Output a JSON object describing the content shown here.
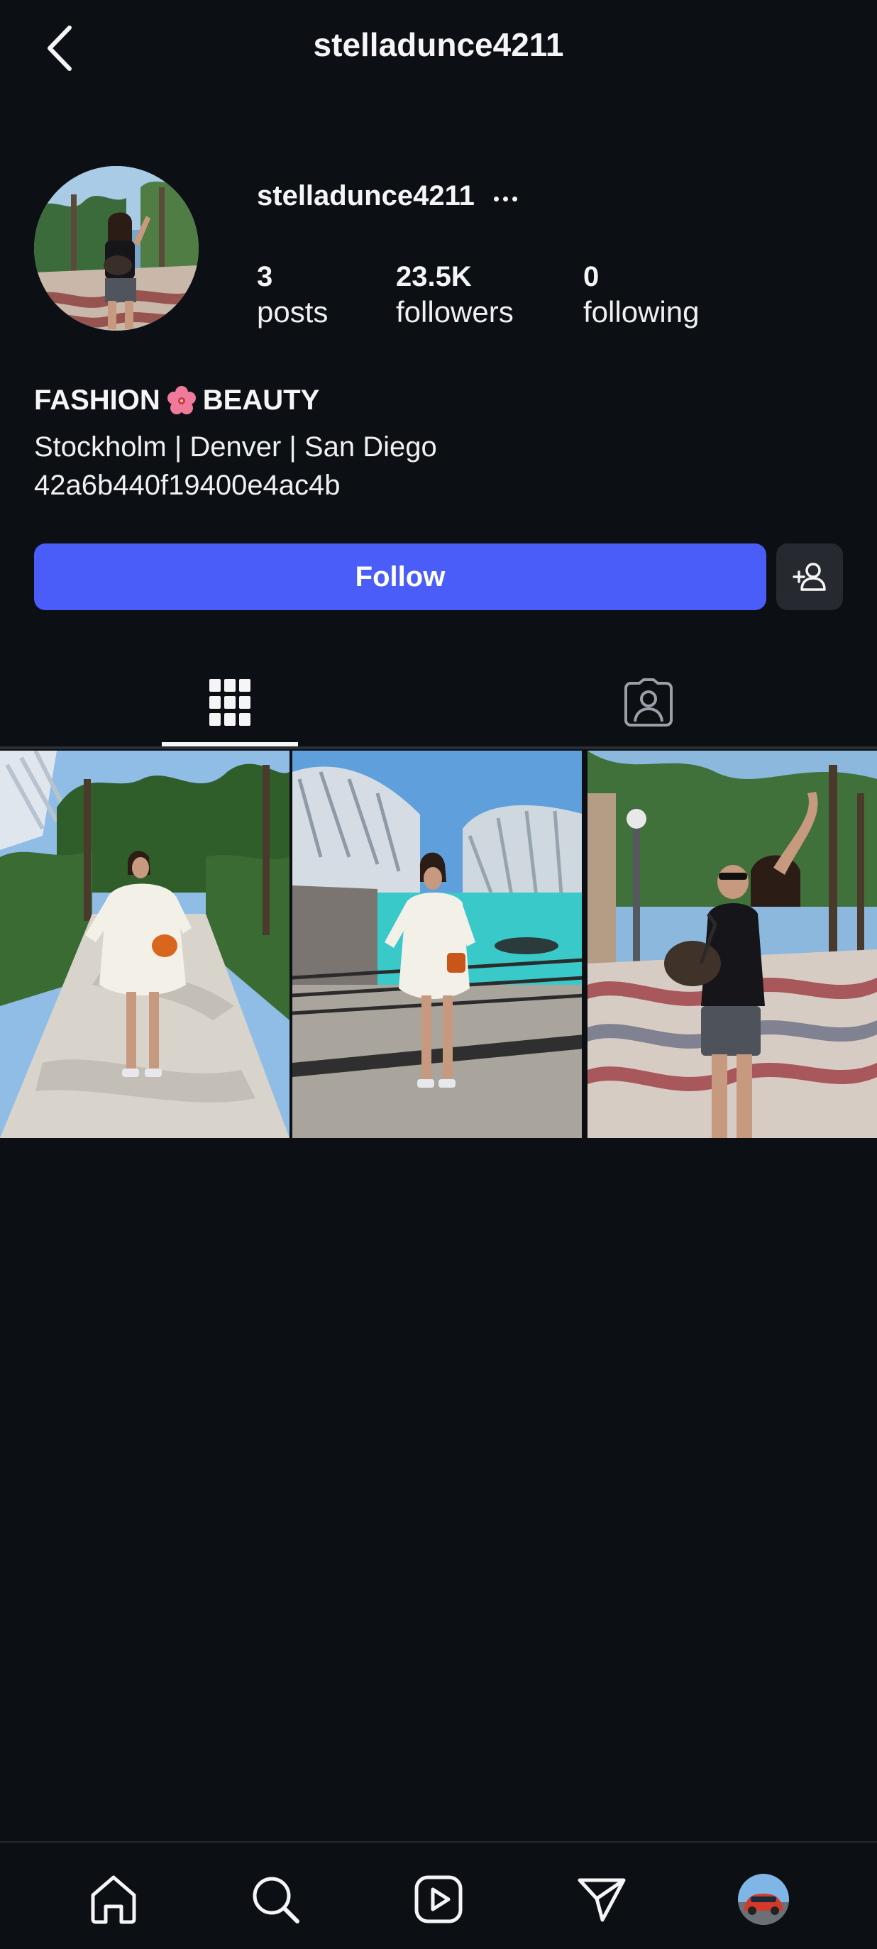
{
  "header": {
    "title": "stelladunce4211",
    "back_icon": "chevron-left-icon"
  },
  "profile": {
    "username": "stelladunce4211",
    "more_icon": "more-horizontal-icon",
    "stats": [
      {
        "value": "3",
        "label": "posts"
      },
      {
        "value": "23.5K",
        "label": "followers"
      },
      {
        "value": "0",
        "label": "following"
      }
    ],
    "bio": {
      "name_left": "FASHION",
      "emoji": "hibiscus-flower-icon",
      "name_right": "BEAUTY",
      "location": "Stockholm | Denver | San Diego",
      "id_line": "42a6b440f19400e4ac4b"
    }
  },
  "actions": {
    "follow_label": "Follow",
    "follow_color": "#4a5df9",
    "add_user_icon": "add-user-icon"
  },
  "tabs": [
    {
      "name": "posts-grid",
      "icon": "grid-icon",
      "active": true
    },
    {
      "name": "tagged",
      "icon": "tagged-person-icon",
      "active": false
    }
  ],
  "posts": [
    {
      "name": "post-1"
    },
    {
      "name": "post-2"
    },
    {
      "name": "post-3"
    }
  ],
  "bottom_nav": [
    {
      "name": "home",
      "icon": "home-icon"
    },
    {
      "name": "search",
      "icon": "search-icon"
    },
    {
      "name": "reels",
      "icon": "reels-play-icon"
    },
    {
      "name": "direct",
      "icon": "paper-plane-icon"
    },
    {
      "name": "profile",
      "icon": "profile-avatar"
    }
  ],
  "colors": {
    "background": "#0c0f14",
    "text": "#f5f5f5",
    "secondary_button": "#262a30"
  }
}
